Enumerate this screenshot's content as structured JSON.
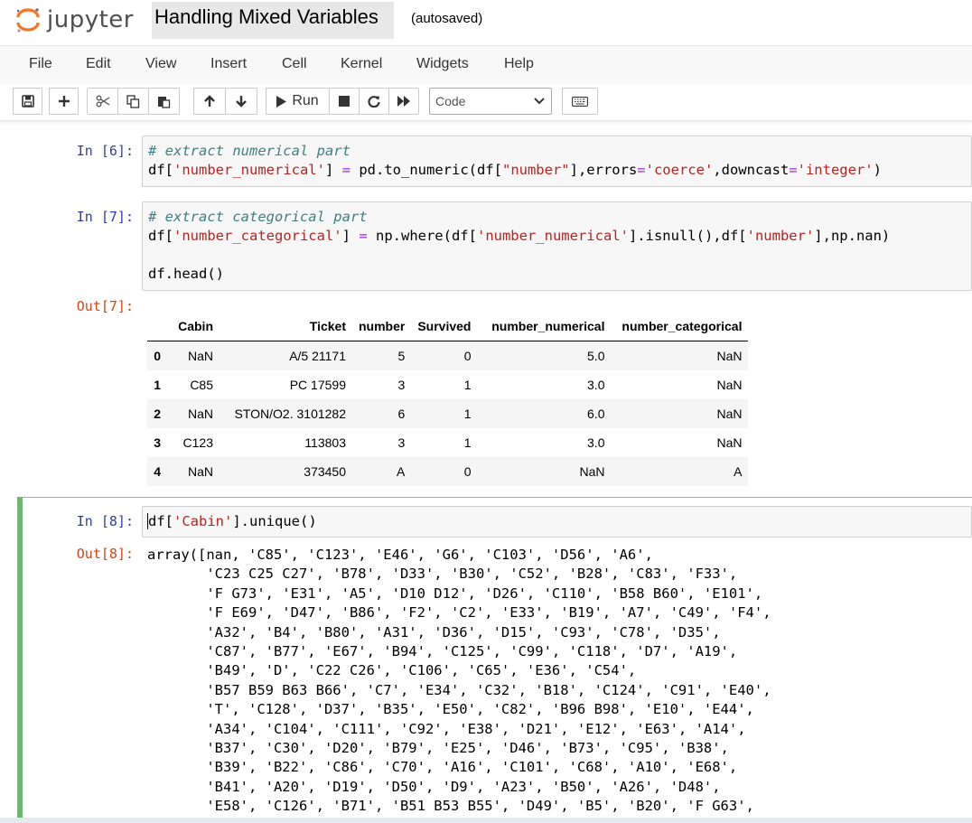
{
  "header": {
    "logo_text": "jupyter",
    "notebook_title": "Handling Mixed Variables",
    "autosave_status": "(autosaved)"
  },
  "menu": [
    "File",
    "Edit",
    "View",
    "Insert",
    "Cell",
    "Kernel",
    "Widgets",
    "Help"
  ],
  "toolbar": {
    "run_label": "Run",
    "cell_type": "Code",
    "icons": [
      "save-icon",
      "plus-icon",
      "cut-icon",
      "copy-icon",
      "paste-icon",
      "arrow-up-icon",
      "arrow-down-icon",
      "run-icon",
      "stop-icon",
      "restart-icon",
      "fast-forward-icon",
      "keyboard-icon"
    ]
  },
  "cells": {
    "c6": {
      "prompt": "In [6]:",
      "line1": "# extract numerical part",
      "line2": {
        "a": "df[",
        "s1": "'number_numerical'",
        "b": "] ",
        "op": "=",
        "c": " pd.to_numeric(df[",
        "s2": "\"number\"",
        "d": "],errors",
        "op2": "=",
        "s3": "'coerce'",
        "e": ",downcast",
        "op3": "=",
        "s4": "'integer'",
        "f": ")"
      }
    },
    "c7": {
      "prompt": "In [7]:",
      "out_prompt": "Out[7]:",
      "line1": "# extract categorical part",
      "line2": {
        "a": "df[",
        "s1": "'number_categorical'",
        "b": "] ",
        "op": "=",
        "c": " np.where(df[",
        "s2": "'number_numerical'",
        "d": "].isnull(),df[",
        "s3": "'number'",
        "e": "],np.nan)"
      },
      "line3": "df.head()"
    },
    "c8": {
      "prompt": "In [8]:",
      "out_prompt": "Out[8]:",
      "code": {
        "a": "df[",
        "s1": "'Cabin'",
        "b": "].unique()"
      }
    }
  },
  "dataframe": {
    "columns": [
      "",
      "Cabin",
      "Ticket",
      "number",
      "Survived",
      "number_numerical",
      "number_categorical"
    ],
    "rows": [
      [
        "0",
        "NaN",
        "A/5 21171",
        "5",
        "0",
        "5.0",
        "NaN"
      ],
      [
        "1",
        "C85",
        "PC 17599",
        "3",
        "1",
        "3.0",
        "NaN"
      ],
      [
        "2",
        "NaN",
        "STON/O2. 3101282",
        "6",
        "1",
        "6.0",
        "NaN"
      ],
      [
        "3",
        "C123",
        "113803",
        "3",
        "1",
        "3.0",
        "NaN"
      ],
      [
        "4",
        "NaN",
        "373450",
        "A",
        "0",
        "NaN",
        "A"
      ]
    ]
  },
  "output8_lines": [
    "array([nan, 'C85', 'C123', 'E46', 'G6', 'C103', 'D56', 'A6',",
    "       'C23 C25 C27', 'B78', 'D33', 'B30', 'C52', 'B28', 'C83', 'F33',",
    "       'F G73', 'E31', 'A5', 'D10 D12', 'D26', 'C110', 'B58 B60', 'E101',",
    "       'F E69', 'D47', 'B86', 'F2', 'C2', 'E33', 'B19', 'A7', 'C49', 'F4',",
    "       'A32', 'B4', 'B80', 'A31', 'D36', 'D15', 'C93', 'C78', 'D35',",
    "       'C87', 'B77', 'E67', 'B94', 'C125', 'C99', 'C118', 'D7', 'A19',",
    "       'B49', 'D', 'C22 C26', 'C106', 'C65', 'E36', 'C54',",
    "       'B57 B59 B63 B66', 'C7', 'E34', 'C32', 'B18', 'C124', 'C91', 'E40',",
    "       'T', 'C128', 'D37', 'B35', 'E50', 'C82', 'B96 B98', 'E10', 'E44',",
    "       'A34', 'C104', 'C111', 'C92', 'E38', 'D21', 'E12', 'E63', 'A14',",
    "       'B37', 'C30', 'D20', 'B79', 'E25', 'D46', 'B73', 'C95', 'B38',",
    "       'B39', 'B22', 'C86', 'C70', 'A16', 'C101', 'C68', 'A10', 'E68',",
    "       'B41', 'A20', 'D19', 'D50', 'D9', 'A23', 'B50', 'A26', 'D48',",
    "       'E58', 'C126', 'B71', 'B51 B53 B55', 'D49', 'B5', 'B20', 'F G63',"
  ]
}
